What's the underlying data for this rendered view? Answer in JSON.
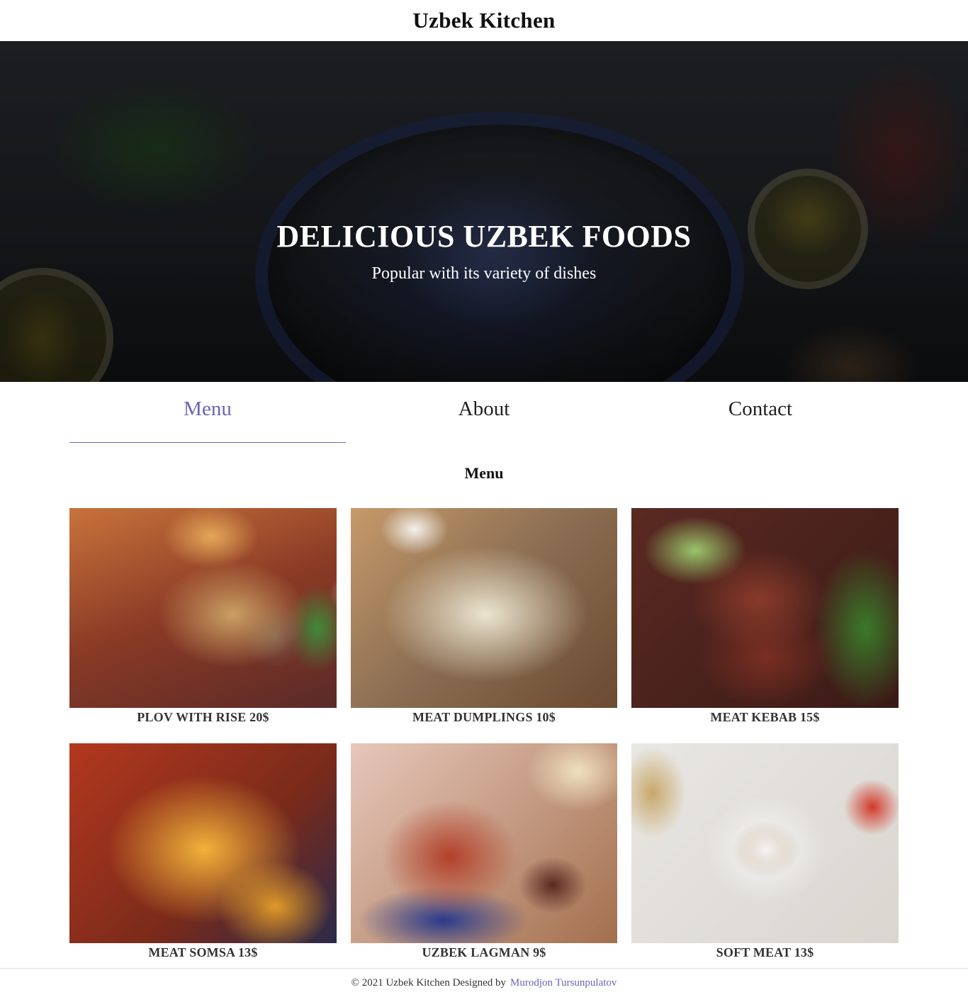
{
  "header": {
    "title": "Uzbek Kitchen"
  },
  "hero": {
    "heading": "DELICIOUS UZBEK FOODS",
    "subheading": "Popular with its variety of dishes"
  },
  "nav": {
    "tabs": [
      {
        "label": "Menu",
        "active": true
      },
      {
        "label": "About",
        "active": false
      },
      {
        "label": "Contact",
        "active": false
      }
    ]
  },
  "menu": {
    "title": "Menu",
    "items": [
      {
        "label": "PLOV WITH RISE 20$",
        "image": "plov-image"
      },
      {
        "label": "MEAT DUMPLINGS 10$",
        "image": "dumplings-image"
      },
      {
        "label": "MEAT KEBAB 15$",
        "image": "kebab-image"
      },
      {
        "label": "MEAT SOMSA 13$",
        "image": "somsa-image"
      },
      {
        "label": "UZBEK LAGMAN 9$",
        "image": "lagman-image"
      },
      {
        "label": "SOFT MEAT 13$",
        "image": "soft-meat-image"
      }
    ]
  },
  "footer": {
    "text": "© 2021 Uzbek Kitchen Designed by",
    "author": "Murodjon Tursunpulatov"
  },
  "colors": {
    "accent": "#6a64b6",
    "text": "#222222",
    "footer_border": "#dddddd"
  }
}
